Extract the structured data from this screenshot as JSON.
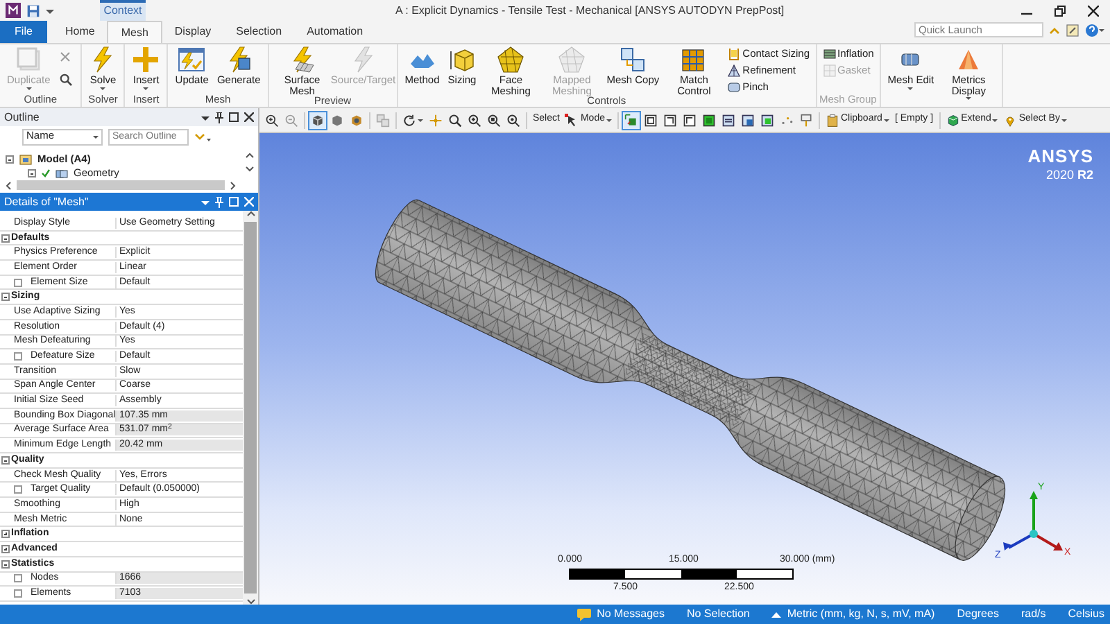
{
  "window": {
    "title": "A : Explicit Dynamics - Tensile Test - Mechanical [ANSYS AUTODYN PrepPost]",
    "context_tab": "Context"
  },
  "tabs": [
    {
      "label": "File",
      "kind": "file",
      "selected": false
    },
    {
      "label": "Home",
      "kind": "tab",
      "selected": false
    },
    {
      "label": "Mesh",
      "kind": "tab",
      "selected": true
    },
    {
      "label": "Display",
      "kind": "tab",
      "selected": false
    },
    {
      "label": "Selection",
      "kind": "tab",
      "selected": false
    },
    {
      "label": "Automation",
      "kind": "tab",
      "selected": false
    }
  ],
  "quick_launch": {
    "placeholder": "Quick Launch"
  },
  "ribbon": [
    {
      "label": "Outline",
      "disabled": false,
      "items": [
        {
          "kind": "large",
          "label": "Duplicate",
          "disabled": true,
          "dropdown": true
        },
        {
          "kind": "icons"
        }
      ]
    },
    {
      "label": "Solver",
      "disabled": false,
      "items": [
        {
          "kind": "large",
          "label": "Solve",
          "disabled": false,
          "dropdown": true
        }
      ]
    },
    {
      "label": "Insert",
      "disabled": false,
      "items": [
        {
          "kind": "large",
          "label": "Insert",
          "disabled": false,
          "dropdown": true
        }
      ]
    },
    {
      "label": "Mesh",
      "disabled": false,
      "items": [
        {
          "kind": "large",
          "label": "Update",
          "disabled": false,
          "dropdown": false
        },
        {
          "kind": "large",
          "label": "Generate",
          "disabled": false,
          "dropdown": false
        }
      ]
    },
    {
      "label": "Preview",
      "disabled": false,
      "items": [
        {
          "kind": "large",
          "label": "Surface Mesh",
          "disabled": false,
          "dropdown": false
        },
        {
          "kind": "large",
          "label": "Source/Target",
          "disabled": true,
          "dropdown": false
        }
      ]
    },
    {
      "label": "Controls",
      "disabled": false,
      "items": [
        {
          "kind": "large",
          "label": "Method",
          "disabled": false,
          "dropdown": false
        },
        {
          "kind": "large",
          "label": "Sizing",
          "disabled": false,
          "dropdown": false
        },
        {
          "kind": "large",
          "label": "Face Meshing",
          "disabled": false,
          "dropdown": false
        },
        {
          "kind": "large",
          "label": "Mapped Meshing",
          "disabled": true,
          "dropdown": false
        },
        {
          "kind": "large",
          "label": "Mesh Copy",
          "disabled": false,
          "dropdown": false
        },
        {
          "kind": "large",
          "label": "Match Control",
          "disabled": false,
          "dropdown": false
        },
        {
          "kind": "small_stack",
          "entries": [
            {
              "label": "Contact Sizing",
              "disabled": false
            },
            {
              "label": "Refinement",
              "disabled": false
            },
            {
              "label": "Pinch",
              "disabled": false
            }
          ]
        }
      ]
    },
    {
      "label": "Mesh Group",
      "disabled": true,
      "items": [
        {
          "kind": "small_stack",
          "entries": [
            {
              "label": "Inflation",
              "disabled": false
            },
            {
              "label": "Gasket",
              "disabled": true
            }
          ]
        }
      ]
    },
    {
      "items": [
        {
          "kind": "large",
          "label": "Mesh Edit",
          "disabled": false,
          "dropdown": true
        },
        {
          "kind": "large",
          "label": "Metrics Display",
          "disabled": false,
          "dropdown": true
        }
      ]
    }
  ],
  "view_toolbar": [
    {
      "kind": "icon",
      "selected": false,
      "dropdown": false
    },
    {
      "kind": "icon",
      "selected": false,
      "dropdown": false
    },
    {
      "kind": "separator"
    },
    {
      "kind": "icon",
      "selected": true,
      "dropdown": false
    },
    {
      "kind": "icon",
      "selected": false,
      "dropdown": false
    },
    {
      "kind": "icon",
      "selected": false,
      "dropdown": false
    },
    {
      "kind": "separator"
    },
    {
      "kind": "icon",
      "selected": false,
      "dropdown": false
    },
    {
      "kind": "separator"
    },
    {
      "kind": "icon",
      "selected": false,
      "dropdown": true
    },
    {
      "kind": "icon",
      "selected": false,
      "dropdown": false
    },
    {
      "kind": "icon",
      "selected": false,
      "dropdown": false
    },
    {
      "kind": "icon",
      "selected": false,
      "dropdown": false
    },
    {
      "kind": "icon",
      "selected": false,
      "dropdown": false
    },
    {
      "kind": "icon",
      "selected": false,
      "dropdown": false
    },
    {
      "kind": "separator"
    },
    {
      "kind": "label",
      "label": "Select",
      "dropdown": false
    },
    {
      "kind": "icon_label",
      "label": "Mode",
      "dropdown": true
    },
    {
      "kind": "separator"
    },
    {
      "kind": "icon",
      "selected": true,
      "dropdown": false
    },
    {
      "kind": "icon",
      "selected": false,
      "dropdown": false
    },
    {
      "kind": "icon",
      "selected": false,
      "dropdown": false
    },
    {
      "kind": "icon",
      "selected": false,
      "dropdown": false
    },
    {
      "kind": "icon",
      "selected": false,
      "dropdown": false
    },
    {
      "kind": "icon",
      "selected": false,
      "dropdown": false
    },
    {
      "kind": "icon",
      "selected": false,
      "dropdown": false
    },
    {
      "kind": "icon",
      "selected": false,
      "dropdown": false
    },
    {
      "kind": "icon",
      "selected": false,
      "dropdown": false
    },
    {
      "kind": "icon",
      "selected": false,
      "dropdown": false
    },
    {
      "kind": "separator"
    },
    {
      "kind": "icon_label",
      "label": "Clipboard",
      "dropdown": true
    },
    {
      "kind": "label",
      "label": "[ Empty ]",
      "dropdown": false
    },
    {
      "kind": "separator"
    },
    {
      "kind": "icon_label",
      "label": "Extend",
      "dropdown": true
    },
    {
      "kind": "icon_label",
      "label": "Select By",
      "dropdown": true
    }
  ],
  "outline": {
    "title": "Outline",
    "filter": {
      "value": "Name"
    },
    "search": {
      "placeholder": "Search Outline"
    },
    "tree": [
      {
        "label": "Model (A4)",
        "expanded": true,
        "children": [
          {
            "label": "Geometry",
            "expanded": true
          }
        ]
      }
    ]
  },
  "details": {
    "title": "Details of \"Mesh\"",
    "rows": [
      {
        "kind": "property",
        "label": "Display Style",
        "value": "Use Geometry Setting",
        "readonly": false
      },
      {
        "kind": "section",
        "label": "Defaults",
        "expanded": true
      },
      {
        "kind": "property",
        "label": "Physics Preference",
        "value": "Explicit",
        "readonly": false
      },
      {
        "kind": "property",
        "label": "Element Order",
        "value": "Linear",
        "readonly": false
      },
      {
        "kind": "check_property",
        "label": "Element Size",
        "value": "Default",
        "readonly": false,
        "checked": false
      },
      {
        "kind": "section",
        "label": "Sizing",
        "expanded": true
      },
      {
        "kind": "property",
        "label": "Use Adaptive Sizing",
        "value": "Yes",
        "readonly": false
      },
      {
        "kind": "property",
        "label": "Resolution",
        "value": "Default (4)",
        "readonly": false
      },
      {
        "kind": "property",
        "label": "Mesh Defeaturing",
        "value": "Yes",
        "readonly": false
      },
      {
        "kind": "check_property",
        "label": "Defeature Size",
        "value": "Default",
        "readonly": false,
        "checked": false
      },
      {
        "kind": "property",
        "label": "Transition",
        "value": "Slow",
        "readonly": false
      },
      {
        "kind": "property",
        "label": "Span Angle Center",
        "value": "Coarse",
        "readonly": false
      },
      {
        "kind": "property",
        "label": "Initial Size Seed",
        "value": "Assembly",
        "readonly": false
      },
      {
        "kind": "property",
        "label": "Bounding Box Diagonal",
        "value": "107.35 mm",
        "readonly": true
      },
      {
        "kind": "property",
        "label": "Average Surface Area",
        "value": "531.07 mm$^{2}$",
        "readonly": true
      },
      {
        "kind": "property",
        "label": "Minimum Edge Length",
        "value": "20.42 mm",
        "readonly": true
      },
      {
        "kind": "section",
        "label": "Quality",
        "expanded": true
      },
      {
        "kind": "property",
        "label": "Check Mesh Quality",
        "value": "Yes, Errors",
        "readonly": false
      },
      {
        "kind": "check_property",
        "label": "Target Quality",
        "value": "Default (0.050000)",
        "readonly": false,
        "checked": false
      },
      {
        "kind": "property",
        "label": "Smoothing",
        "value": "High",
        "readonly": false
      },
      {
        "kind": "property",
        "label": "Mesh Metric",
        "value": "None",
        "readonly": false
      },
      {
        "kind": "section",
        "label": "Inflation",
        "expanded": false
      },
      {
        "kind": "section",
        "label": "Advanced",
        "expanded": false
      },
      {
        "kind": "section",
        "label": "Statistics",
        "expanded": true
      },
      {
        "kind": "check_property",
        "label": "Nodes",
        "value": "1666",
        "readonly": true,
        "checked": false
      },
      {
        "kind": "check_property",
        "label": "Elements",
        "value": "7103",
        "readonly": true,
        "checked": false
      }
    ]
  },
  "viewport": {
    "logo": {
      "name": "ANSYS",
      "version": "2020 **R2**"
    },
    "scale_bar": {
      "top_labels": [
        "0.000",
        "15.000",
        "30.000 (mm)"
      ],
      "bottom_labels": [
        "7.500",
        "22.500"
      ]
    },
    "axes": {
      "y": "Y",
      "z": "Z",
      "x": "X"
    }
  },
  "status_bar": [
    {
      "kind": "messages",
      "label": "No Messages"
    },
    {
      "kind": "text",
      "label": "No Selection"
    },
    {
      "kind": "units",
      "label": "Metric (mm, kg, N, s, mV, mA)"
    },
    {
      "kind": "text",
      "label": "Degrees"
    },
    {
      "kind": "text",
      "label": "rad/s"
    },
    {
      "kind": "text",
      "label": "Celsius"
    }
  ]
}
